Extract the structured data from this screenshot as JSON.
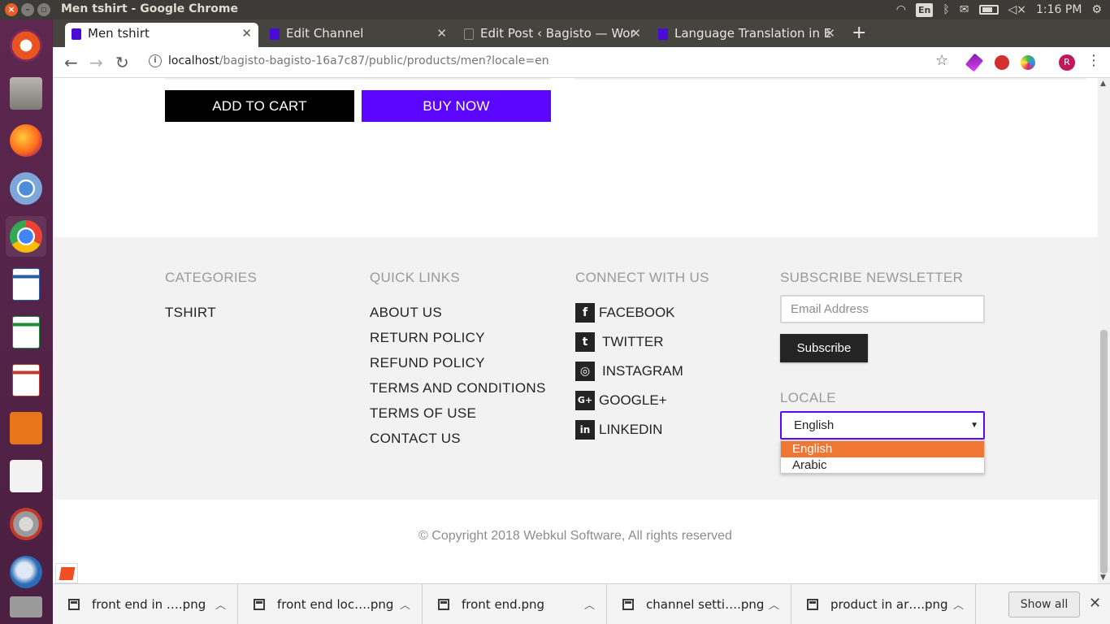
{
  "os": {
    "window_title": "Men tshirt - Google Chrome",
    "lang_indicator": "En",
    "clock": "1:16 PM"
  },
  "browser": {
    "tabs": [
      {
        "label": "Men tshirt",
        "active": true
      },
      {
        "label": "Edit Channel",
        "active": false
      },
      {
        "label": "Edit Post ‹ Bagisto — Wor",
        "active": false
      },
      {
        "label": "Language Translation in E",
        "active": false
      }
    ],
    "new_tab_label": "+",
    "url_host": "localhost",
    "url_path": "/bagisto-bagisto-16a7c87/public/products/men?locale=en",
    "profile_initial": "R"
  },
  "product": {
    "add_to_cart_label": "ADD TO CART",
    "buy_now_label": "BUY NOW"
  },
  "footer": {
    "categories": {
      "heading": "CATEGORIES",
      "items": [
        "TSHIRT"
      ]
    },
    "quick_links": {
      "heading": "QUICK LINKS",
      "items": [
        "ABOUT US",
        "RETURN POLICY",
        "REFUND POLICY",
        "TERMS AND CONDITIONS",
        "TERMS OF USE",
        "CONTACT US"
      ]
    },
    "connect": {
      "heading": "CONNECT WITH US",
      "items": [
        {
          "label": "FACEBOOK",
          "icon": "facebook-icon",
          "glyph": "f"
        },
        {
          "label": "TWITTER",
          "icon": "twitter-icon",
          "glyph": "t"
        },
        {
          "label": "INSTAGRAM",
          "icon": "instagram-icon",
          "glyph": "◎"
        },
        {
          "label": "GOOGLE+",
          "icon": "google-plus-icon",
          "glyph": "G+"
        },
        {
          "label": "LINKEDIN",
          "icon": "linkedin-icon",
          "glyph": "in"
        }
      ]
    },
    "newsletter": {
      "heading": "SUBSCRIBE NEWSLETTER",
      "email_placeholder": "Email Address",
      "subscribe_label": "Subscribe"
    },
    "locale": {
      "heading": "LOCALE",
      "selected": "English",
      "options": [
        "English",
        "Arabic"
      ]
    },
    "copyright": "© Copyright 2018 Webkul Software, All rights reserved"
  },
  "downloads": {
    "items": [
      "front end in ….png",
      "front end loc….png",
      "front end.png",
      "channel setti….png",
      "product in ar….png"
    ],
    "show_all_label": "Show all"
  },
  "colors": {
    "accent_purple": "#5b06ff",
    "dropdown_highlight": "#f07634",
    "footer_bg": "#f2f2f2"
  }
}
